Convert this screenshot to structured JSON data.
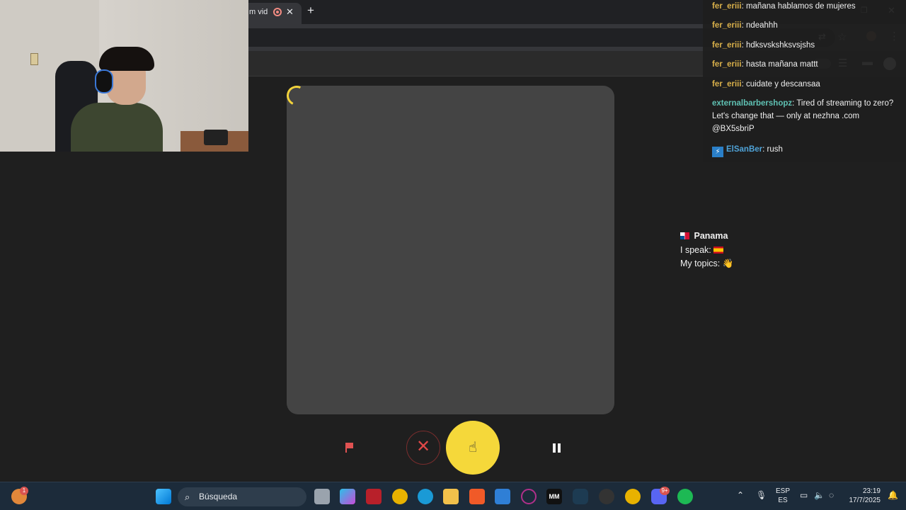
{
  "browser": {
    "tab_title": "m vid",
    "close_tab": "✕",
    "new_tab": "+"
  },
  "chat": {
    "messages": [
      {
        "user": "fer_eriii",
        "text": "mañana hablamos de mujeres"
      },
      {
        "user": "fer_eriii",
        "text": "ndeahhh"
      },
      {
        "user": "fer_eriii",
        "text": "hdksvskshksvsjshs"
      },
      {
        "user": "fer_eriii",
        "text": "hasta mañana mattt"
      },
      {
        "user": "fer_eriii",
        "text": "cuidate y descansaa"
      },
      {
        "user": "externalbarbershopz",
        "text": "Tired of streaming to zero? Let's change that — only at nezhna .com @BX5sbriP"
      },
      {
        "user": "ElSanBer",
        "text": "rush"
      }
    ]
  },
  "peer": {
    "country": "Panama",
    "speak_label": "I speak:",
    "topics_label": "My topics:",
    "topics_emoji": "👋"
  },
  "controls": {
    "skip_symbol": "✕"
  },
  "taskbar": {
    "search_placeholder": "Búsqueda",
    "notification_count": "1",
    "discord_badge": "9+",
    "lang_top": "ESP",
    "lang_bottom": "ES",
    "time": "23:19",
    "date": "17/7/2025"
  },
  "colors": {
    "accent_yellow": "#f5d83a",
    "skip_red": "#e04848",
    "card_bg": "#444444",
    "page_bg": "#1f1f1f"
  }
}
